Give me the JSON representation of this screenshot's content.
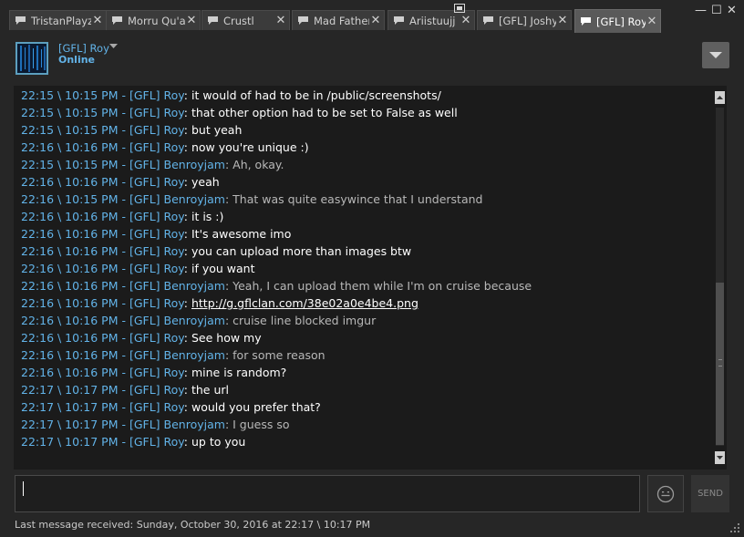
{
  "tabs": [
    {
      "label": "TristanPlayz",
      "close": "✕"
    },
    {
      "label": "Morru Qu'a...",
      "close": "✕"
    },
    {
      "label": "Crustl",
      "close": "✕"
    },
    {
      "label": "Mad Father",
      "close": "✕"
    },
    {
      "label": "Ariistuujj",
      "close": "✕"
    },
    {
      "label": "[GFL] Joshy",
      "close": "✕"
    },
    {
      "label": "[GFL] Roy",
      "close": "✕",
      "active": true
    }
  ],
  "window": {
    "minimize": "—",
    "maximize": "☐",
    "close": "✕"
  },
  "header": {
    "name": "[GFL] Roy",
    "status": "Online"
  },
  "messages": [
    {
      "ts": "22:15 \\ 10:15 PM - ",
      "name": "[GFL] Roy",
      "sep": ": ",
      "text": "it would of had to be in /public/screenshots/"
    },
    {
      "ts": "22:15 \\ 10:15 PM - ",
      "name": "[GFL] Roy",
      "sep": ": ",
      "text": "that other option had to be set to False as well"
    },
    {
      "ts": "22:15 \\ 10:15 PM - ",
      "name": "[GFL] Roy",
      "sep": ": ",
      "text": "but yeah"
    },
    {
      "ts": "22:16 \\ 10:16 PM - ",
      "name": "[GFL] Roy",
      "sep": ": ",
      "text": "now you're unique :)"
    },
    {
      "ts": "22:15 \\ 10:15 PM - ",
      "name": "[GFL] Benroyjam",
      "sep": ": ",
      "text": "Ah, okay."
    },
    {
      "ts": "22:16 \\ 10:16 PM - ",
      "name": "[GFL] Roy",
      "sep": ": ",
      "text": "yeah"
    },
    {
      "ts": "22:16 \\ 10:15 PM - ",
      "name": "[GFL] Benroyjam",
      "sep": ": ",
      "text": "That was quite easywince that I understand"
    },
    {
      "ts": "22:16 \\ 10:16 PM - ",
      "name": "[GFL] Roy",
      "sep": ": ",
      "text": "it is :)"
    },
    {
      "ts": "22:16 \\ 10:16 PM - ",
      "name": "[GFL] Roy",
      "sep": ": ",
      "text": "It's awesome imo"
    },
    {
      "ts": "22:16 \\ 10:16 PM - ",
      "name": "[GFL] Roy",
      "sep": ": ",
      "text": "you can upload more than images btw"
    },
    {
      "ts": "22:16 \\ 10:16 PM - ",
      "name": "[GFL] Roy",
      "sep": ": ",
      "text": "if you want"
    },
    {
      "ts": "22:16 \\ 10:16 PM - ",
      "name": "[GFL] Benroyjam",
      "sep": ": ",
      "text": "Yeah, I can upload them while I'm on cruise because"
    },
    {
      "ts": "22:16 \\ 10:16 PM - ",
      "name": "[GFL] Roy",
      "sep": ": ",
      "text": "http://g.gflclan.com/38e02a0e4be4.png",
      "link": true
    },
    {
      "ts": "22:16 \\ 10:16 PM - ",
      "name": "[GFL] Benroyjam",
      "sep": ": ",
      "text": "cruise line blocked imgur"
    },
    {
      "ts": "22:16 \\ 10:16 PM - ",
      "name": "[GFL] Roy",
      "sep": ": ",
      "text": "See how my"
    },
    {
      "ts": "22:16 \\ 10:16 PM - ",
      "name": "[GFL] Benroyjam",
      "sep": ": ",
      "text": "for some reason"
    },
    {
      "ts": "22:16 \\ 10:16 PM - ",
      "name": "[GFL] Roy",
      "sep": ": ",
      "text": "mine is random?"
    },
    {
      "ts": "22:17 \\ 10:17 PM - ",
      "name": "[GFL] Roy",
      "sep": ": ",
      "text": "the url"
    },
    {
      "ts": "22:17 \\ 10:17 PM - ",
      "name": "[GFL] Roy",
      "sep": ": ",
      "text": "would you prefer that?"
    },
    {
      "ts": "22:17 \\ 10:17 PM - ",
      "name": "[GFL] Benroyjam",
      "sep": ": ",
      "text": "I guess so"
    },
    {
      "ts": "22:17 \\ 10:17 PM - ",
      "name": "[GFL] Roy",
      "sep": ": ",
      "text": "up to you"
    }
  ],
  "composer": {
    "value": "",
    "send_label": "SEND"
  },
  "footer": {
    "status": "Last message received: Sunday, October 30, 2016 at 22:17 \\ 10:17 PM"
  },
  "colors": {
    "accent": "#62b3e8",
    "background": "#262626",
    "log_background": "#1b1b1b"
  },
  "icons": [
    "chat-bubble-icon",
    "close-icon",
    "minimize-icon",
    "maximize-icon",
    "chevron-down-icon",
    "menu-dropdown-icon",
    "emoji-icon",
    "resize-grip-icon"
  ]
}
